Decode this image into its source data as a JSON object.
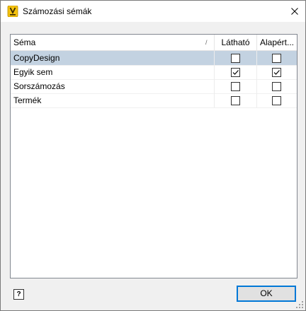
{
  "window": {
    "title": "Számozási sémák",
    "close_glyph": "✕"
  },
  "table": {
    "columns": [
      {
        "label": "Séma",
        "sort_glyph": "/"
      },
      {
        "label": "Látható"
      },
      {
        "label": "Alapért..."
      }
    ],
    "rows": [
      {
        "name": "CopyDesign",
        "visible": false,
        "default": false,
        "selected": true
      },
      {
        "name": "Egyik sem",
        "visible": true,
        "default": true,
        "selected": false
      },
      {
        "name": "Sorszámozás",
        "visible": false,
        "default": false,
        "selected": false
      },
      {
        "name": "Termék",
        "visible": false,
        "default": false,
        "selected": false
      }
    ]
  },
  "footer": {
    "help_label": "?",
    "ok_label": "OK"
  },
  "colors": {
    "selected_row": "#c3d2e1",
    "accent": "#0078d7",
    "icon_yellow": "#f4c20d"
  }
}
